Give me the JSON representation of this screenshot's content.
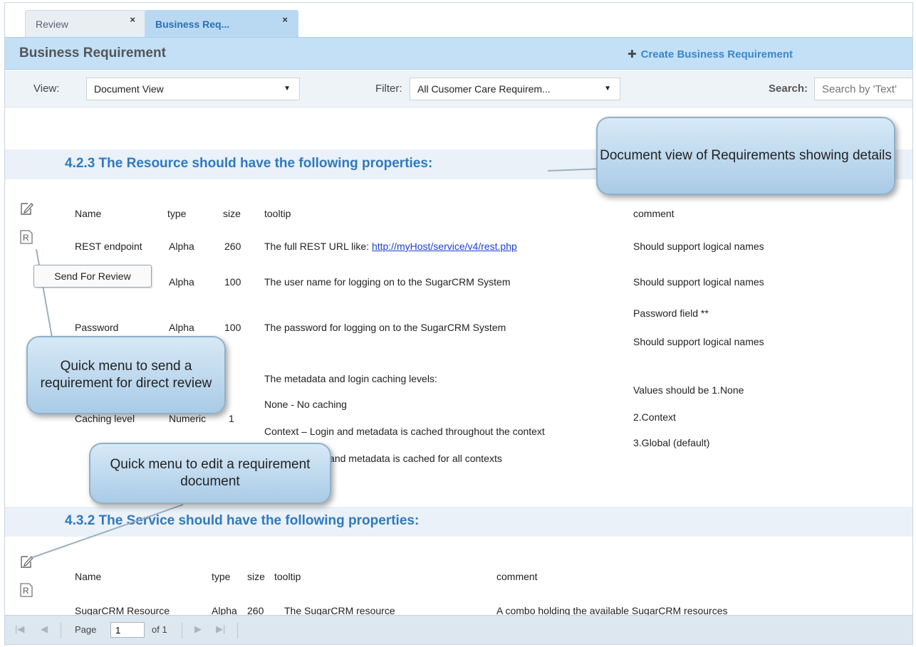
{
  "tabs": [
    {
      "label": "Review",
      "close": "×"
    },
    {
      "label": "Business Req...",
      "close": "×"
    }
  ],
  "header": {
    "title": "Business Requirement",
    "create_icon": "✚",
    "create_label": "Create Business Requirement"
  },
  "toolbar": {
    "view_label": "View:",
    "view_value": "Document View",
    "filter_label": "Filter:",
    "filter_value": "All Cusomer Care Requirem...",
    "search_label": "Search:",
    "search_placeholder": "Search by 'Text'"
  },
  "section1": {
    "title": "4.2.3 The Resource should have the following properties:",
    "headers": {
      "name": "Name",
      "type": "type",
      "size": "size",
      "tooltip": "tooltip",
      "comment": "comment"
    },
    "rows": [
      {
        "name": "REST endpoint",
        "type": "Alpha",
        "size": "260",
        "tooltip_prefix": "The full REST URL like: ",
        "tooltip_link": "http://myHost/service/v4/rest.php",
        "comment": "Should support logical names"
      },
      {
        "name": "",
        "type": "Alpha",
        "size": "100",
        "tooltip": "The user name for logging on to the SugarCRM System",
        "comment": "Should support logical names"
      },
      {
        "name": "Password",
        "type": "Alpha",
        "size": "100",
        "tooltip": "The password for logging on to the SugarCRM System",
        "comment_1": "Password field **",
        "comment_2": "Should support logical names"
      },
      {
        "name": "Caching level",
        "type": "Numeric",
        "size": "1",
        "tooltip_lines": [
          "The metadata and login caching levels:",
          "None - No caching",
          "Context – Login and metadata is cached throughout the context",
          "Global - Login and metadata is cached for all contexts"
        ],
        "comment_lines": [
          "Values should be 1.None",
          "2.Context",
          "3.Global (default)"
        ]
      }
    ]
  },
  "section2": {
    "title": "4.3.2 The Service should have the following properties:",
    "headers": {
      "name": "Name",
      "type": "type",
      "size": "size",
      "tooltip": "tooltip",
      "comment": "comment"
    },
    "rows": [
      {
        "name": "SugarCRM Resource",
        "type": "Alpha",
        "size": "260",
        "tooltip": "The SugarCRM resource",
        "comment": "A combo holding the available SugarCRM resources"
      }
    ]
  },
  "send_for_review": "Send For Review",
  "callouts": {
    "document_view": "Document view of Requirements showing details",
    "send_review": "Quick menu to send a requirement for direct review",
    "edit": "Quick menu to edit a requirement document"
  },
  "pager": {
    "page_label": "Page",
    "page_value": "1",
    "of_label": "of 1"
  },
  "colors": {
    "accent": "#2f79bd",
    "header_bg": "#c3e0f7",
    "link": "#1a3fd3"
  }
}
